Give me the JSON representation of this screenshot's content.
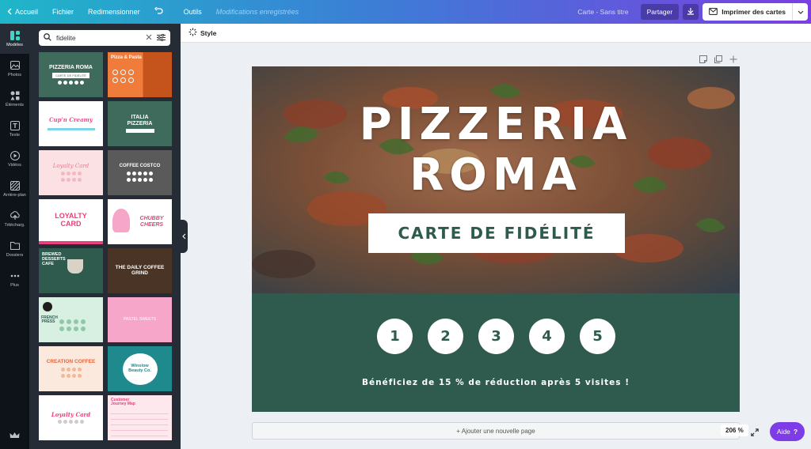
{
  "topbar": {
    "home": "Accueil",
    "file": "Fichier",
    "resize": "Redimensionner",
    "tools": "Outils",
    "saved_status": "Modifications enregistrées",
    "doc_title": "Carte - Sans titre",
    "share": "Partager",
    "print": "Imprimer des cartes"
  },
  "leftnav": {
    "items": [
      {
        "label": "Modèles",
        "icon": "templates-icon"
      },
      {
        "label": "Photos",
        "icon": "photos-icon"
      },
      {
        "label": "Éléments",
        "icon": "elements-icon"
      },
      {
        "label": "Texte",
        "icon": "text-icon"
      },
      {
        "label": "Vidéos",
        "icon": "video-icon"
      },
      {
        "label": "Arrière-plan",
        "icon": "background-icon"
      },
      {
        "label": "Télécharg.",
        "icon": "upload-icon"
      },
      {
        "label": "Dossiers",
        "icon": "folder-icon"
      },
      {
        "label": "Plus",
        "icon": "more-icon"
      }
    ]
  },
  "search": {
    "value": "fidelite"
  },
  "templates": [
    {
      "title": "PIZZERIA ROMA",
      "sub": "CARTE DE FIDÉLITÉ",
      "bg": "#3f6b5c",
      "fg": "#ffffff"
    },
    {
      "title": "Pizza & Pasta",
      "sub": "",
      "bg": "#f07c3c",
      "fg": "#ffffff"
    },
    {
      "title": "Cup'n Creamy",
      "sub": "",
      "bg": "#ffffff",
      "fg": "#e84c8b"
    },
    {
      "title": "ITALIA PIZZERIA",
      "sub": "",
      "bg": "#3f6b5c",
      "fg": "#ffffff"
    },
    {
      "title": "Loyalty Card",
      "sub": "",
      "bg": "#f9d6dc",
      "fg": "#e87a8b"
    },
    {
      "title": "COFFEE COSTCO",
      "sub": "",
      "bg": "#5a5a5a",
      "fg": "#ffffff"
    },
    {
      "title": "LOYALTY CARD",
      "sub": "",
      "bg": "#ffffff",
      "fg": "#e8407a"
    },
    {
      "title": "CHUBBY CHEERS",
      "sub": "",
      "bg": "#ffffff",
      "fg": "#e8407a"
    },
    {
      "title": "BREWED DESSERTS CAFE",
      "sub": "",
      "bg": "#2f5b4f",
      "fg": "#ffffff"
    },
    {
      "title": "THE DAILY COFFEE GRIND",
      "sub": "",
      "bg": "#4a3426",
      "fg": "#ffffff"
    },
    {
      "title": "FRENCH PRESS",
      "sub": "",
      "bg": "#d8f0e2",
      "fg": "#2f5b4f"
    },
    {
      "title": "PASTEL SWEETS",
      "sub": "",
      "bg": "#f6a6c8",
      "fg": "#ffffff"
    },
    {
      "title": "CREATION COFFEE",
      "sub": "",
      "bg": "#fbe9dd",
      "fg": "#e8643c"
    },
    {
      "title": "Winslow Beauty Co.",
      "sub": "",
      "bg": "#1e8a8e",
      "fg": "#1e8a8e"
    },
    {
      "title": "Loyalty Card",
      "sub": "",
      "bg": "#ffffff",
      "fg": "#e8407a"
    },
    {
      "title": "Customer Journey Map",
      "sub": "",
      "bg": "#fde8ee",
      "fg": "#e8407a"
    }
  ],
  "toolbar": {
    "style": "Style"
  },
  "card": {
    "title_line1": "PIZZERIA",
    "title_line2": "ROMA",
    "subtitle": "CARTE DE FIDÉLITÉ",
    "stamps": [
      "1",
      "2",
      "3",
      "4",
      "5"
    ],
    "offer": "Bénéficiez de 15 % de réduction après 5 visites !",
    "colors": {
      "green": "#2f5b4f",
      "white": "#ffffff"
    }
  },
  "footer": {
    "add_page": "+ Ajouter une nouvelle page",
    "zoom": "206 %",
    "help": "Aide"
  }
}
